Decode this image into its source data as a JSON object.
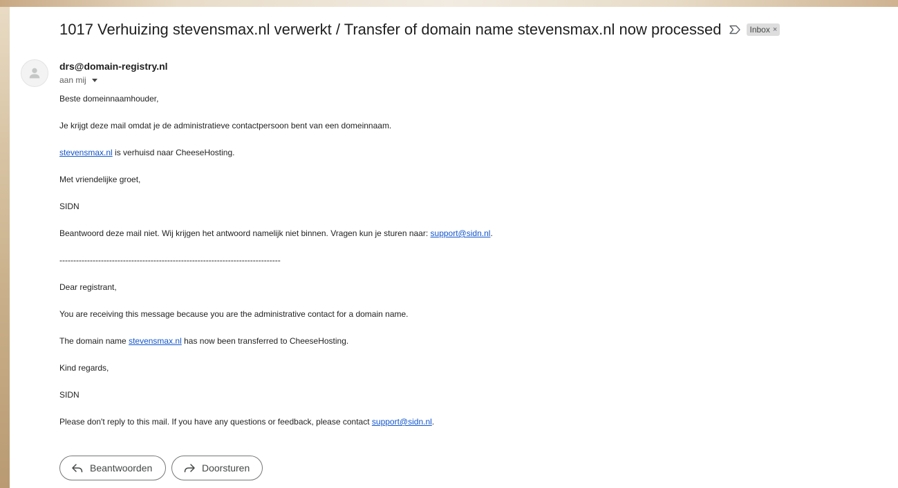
{
  "email": {
    "subject": "1017 Verhuizing stevensmax.nl verwerkt / Transfer of domain name stevensmax.nl now processed",
    "label": "Inbox",
    "label_close": "×",
    "sender": "drs@domain-registry.nl",
    "recipient": "aan mij"
  },
  "body": {
    "greeting_nl": "Beste domeinnaamhouder,",
    "intro_nl": "Je krijgt deze mail omdat je de administratieve contactpersoon bent van een domeinnaam.",
    "domain_link_nl": "stevensmax.nl",
    "transfer_nl": " is verhuisd naar CheeseHosting.",
    "closing_nl": "Met vriendelijke groet,",
    "signature_nl": "SIDN",
    "noreply_nl": "Beantwoord deze mail niet. Wij krijgen het antwoord namelijk niet binnen. Vragen kun je sturen naar: ",
    "support_email_nl": "support@sidn.nl",
    "noreply_end_nl": ".",
    "separator": "--------------------------------------------------------------------------------",
    "greeting_en": "Dear registrant,",
    "intro_en": "You are receiving this message because you are the administrative contact for a domain name.",
    "transfer_en_prefix": "The domain name ",
    "domain_link_en": "stevensmax.nl",
    "transfer_en_suffix": " has now been transferred to CheeseHosting.",
    "closing_en": "Kind regards,",
    "signature_en": "SIDN",
    "noreply_en": "Please don't reply to this mail. If you have any questions or feedback, please contact ",
    "support_email_en": "support@sidn.nl",
    "noreply_end_en": "."
  },
  "actions": {
    "reply_label": "Beantwoorden",
    "forward_label": "Doorsturen"
  },
  "icons": {
    "important": "important-marker-icon",
    "avatar": "person-icon",
    "reply": "reply-arrow-icon",
    "forward": "forward-arrow-icon"
  }
}
